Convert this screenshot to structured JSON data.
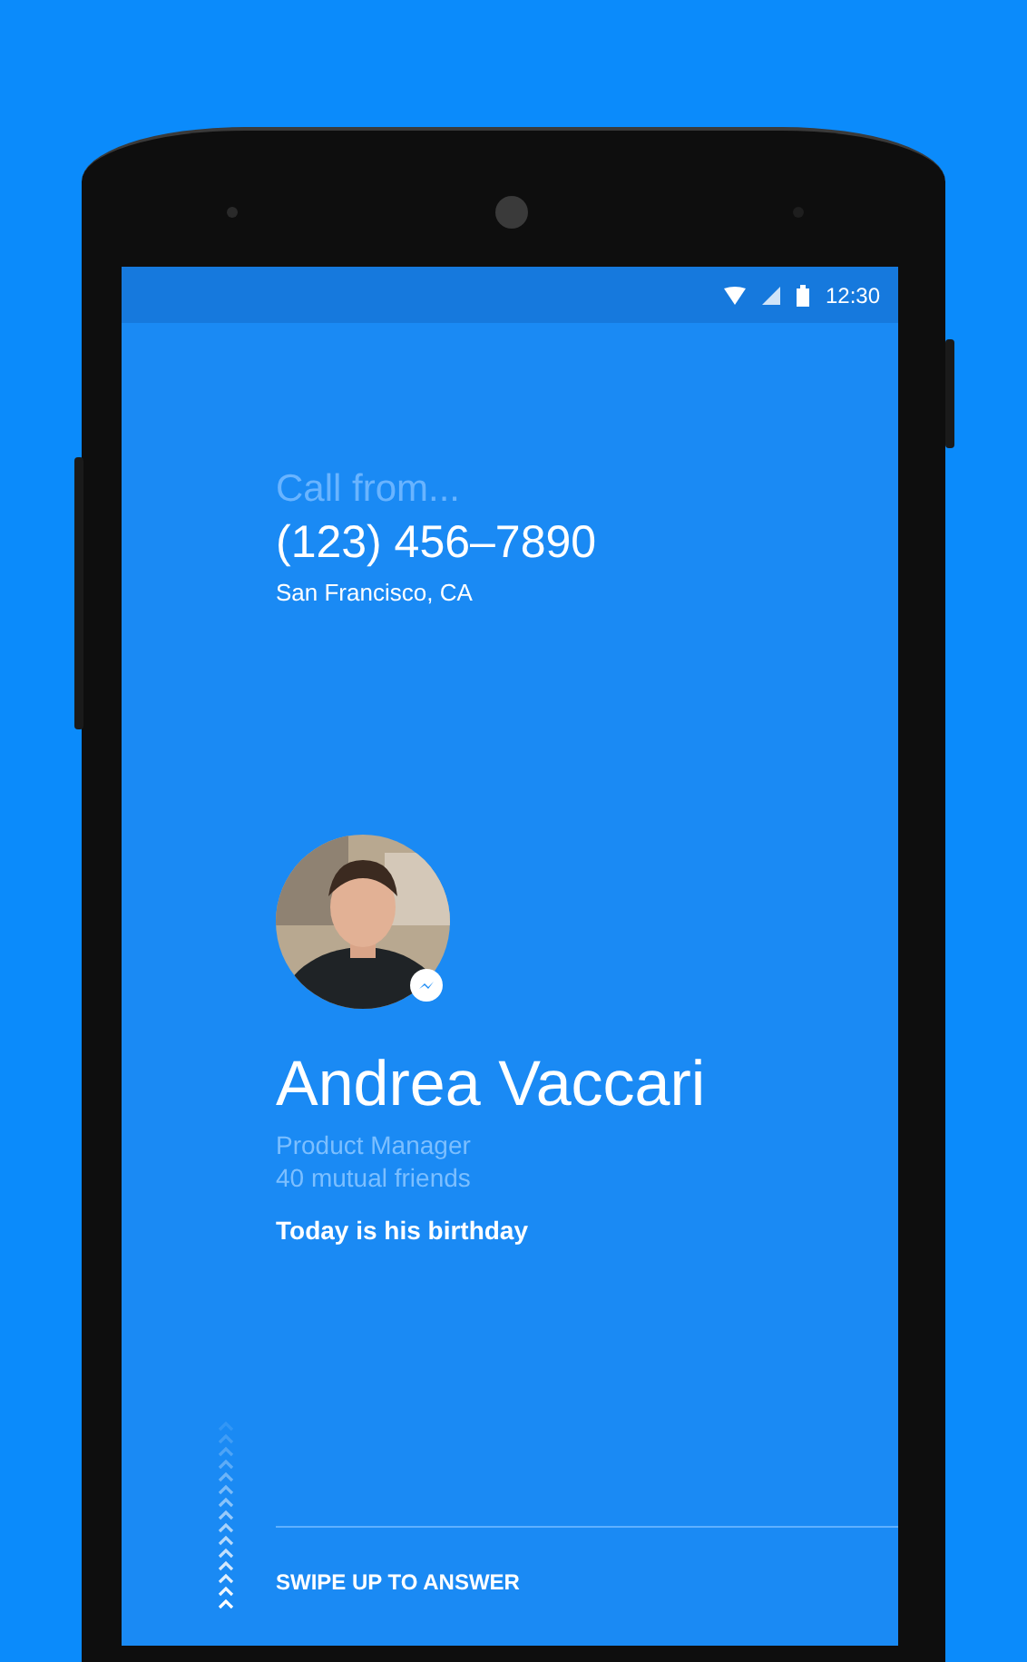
{
  "status_bar": {
    "time": "12:30"
  },
  "call": {
    "label": "Call from...",
    "number": "(123) 456–7890",
    "location": "San Francisco, CA"
  },
  "contact": {
    "name": "Andrea Vaccari",
    "title": "Product Manager",
    "mutual_friends": "40 mutual friends",
    "note": "Today is his birthday"
  },
  "answer_hint": "SWIPE UP TO ANSWER"
}
